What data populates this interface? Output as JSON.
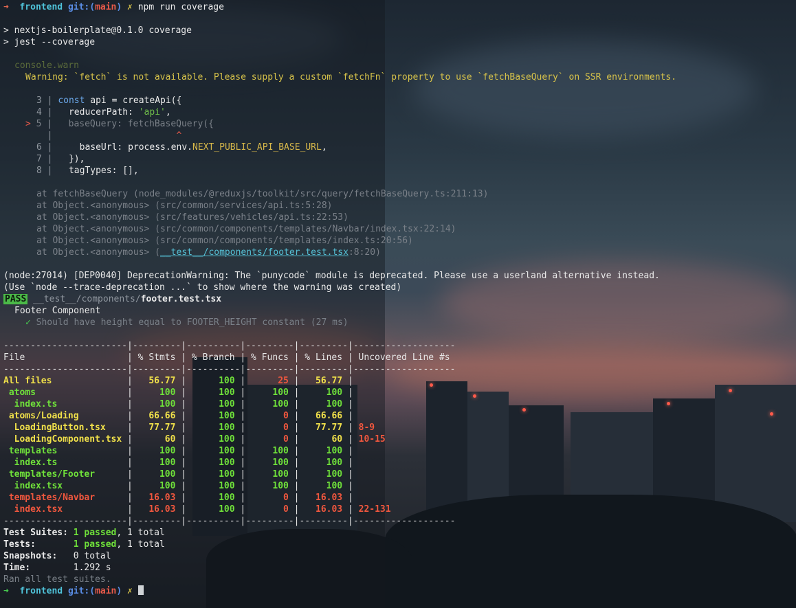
{
  "prompt": {
    "arrow": "➜",
    "dir": "frontend",
    "git_label": "git:",
    "branch_open": "(",
    "branch": "main",
    "branch_close": ")",
    "dirty": "✗",
    "command": "npm run coverage"
  },
  "npm_lines": [
    "> nextjs-boilerplate@0.1.0 coverage",
    "> jest --coverage"
  ],
  "console_warn": {
    "label": "console.warn",
    "message": "Warning: `fetch` is not available. Please supply a custom `fetchFn` property to use `fetchBaseQuery` on SSR environments."
  },
  "code_frame": {
    "l3_num": "3",
    "l3_kw": "const",
    "l3_rest": " api = createApi({",
    "l4_num": "4",
    "l4_a": "reducerPath: ",
    "l4_str": "'api'",
    "l4_b": ",",
    "l5_marker": ">",
    "l5_num": "5",
    "l5_code": "baseQuery: fetchBaseQuery({",
    "caret": "^",
    "l6_num": "6",
    "l6_a": "baseUrl: process.env.",
    "l6_env": "NEXT_PUBLIC_API_BASE_URL",
    "l6_b": ",",
    "l7_num": "7",
    "l7_code": "}),",
    "l8_num": "8",
    "l8_code": "tagTypes: [],"
  },
  "stack": [
    "at fetchBaseQuery (node_modules/@reduxjs/toolkit/src/query/fetchBaseQuery.ts:211:13)",
    "at Object.<anonymous> (src/common/services/api.ts:5:28)",
    "at Object.<anonymous> (src/features/vehicles/api.ts:22:53)",
    "at Object.<anonymous> (src/common/components/templates/Navbar/index.tsx:22:14)",
    "at Object.<anonymous> (src/common/components/templates/index.ts:20:56)"
  ],
  "stack_last": {
    "prefix": "at Object.<anonymous> (",
    "link": "__test__/components/footer.test.tsx",
    "suffix": ":8:20)"
  },
  "deprecation": [
    "(node:27014) [DEP0040] DeprecationWarning: The `punycode` module is deprecated. Please use a userland alternative instead.",
    "(Use `node --trace-deprecation ...` to show where the warning was created)"
  ],
  "test_result": {
    "badge": "PASS",
    "path_dir": "__test__/components/",
    "path_file": "footer.test.tsx",
    "suite": "Footer Component",
    "check": "✓",
    "case": "Should have height equal to FOOTER_HEIGHT constant (27 ms)"
  },
  "coverage": {
    "separator": "-----------------------|---------|----------|---------|---------|-------------------",
    "header": "File                   | % Stmts | % Branch | % Funcs | % Lines | Uncovered Line #s ",
    "rows": [
      {
        "file": "All files",
        "stmts": "56.77",
        "branch": "100",
        "funcs": "25",
        "lines": "56.77",
        "uncovered": ""
      },
      {
        "file": " atoms",
        "stmts": "100",
        "branch": "100",
        "funcs": "100",
        "lines": "100",
        "uncovered": ""
      },
      {
        "file": "  index.ts",
        "stmts": "100",
        "branch": "100",
        "funcs": "100",
        "lines": "100",
        "uncovered": ""
      },
      {
        "file": " atoms/Loading",
        "stmts": "66.66",
        "branch": "100",
        "funcs": "0",
        "lines": "66.66",
        "uncovered": ""
      },
      {
        "file": "  LoadingButton.tsx",
        "stmts": "77.77",
        "branch": "100",
        "funcs": "0",
        "lines": "77.77",
        "uncovered": "8-9"
      },
      {
        "file": "  LoadingComponent.tsx",
        "stmts": "60",
        "branch": "100",
        "funcs": "0",
        "lines": "60",
        "uncovered": "10-15"
      },
      {
        "file": " templates",
        "stmts": "100",
        "branch": "100",
        "funcs": "100",
        "lines": "100",
        "uncovered": ""
      },
      {
        "file": "  index.ts",
        "stmts": "100",
        "branch": "100",
        "funcs": "100",
        "lines": "100",
        "uncovered": ""
      },
      {
        "file": " templates/Footer",
        "stmts": "100",
        "branch": "100",
        "funcs": "100",
        "lines": "100",
        "uncovered": ""
      },
      {
        "file": "  index.tsx",
        "stmts": "100",
        "branch": "100",
        "funcs": "100",
        "lines": "100",
        "uncovered": ""
      },
      {
        "file": " templates/Navbar",
        "stmts": "16.03",
        "branch": "100",
        "funcs": "0",
        "lines": "16.03",
        "uncovered": ""
      },
      {
        "file": "  index.tsx",
        "stmts": "16.03",
        "branch": "100",
        "funcs": "0",
        "lines": "16.03",
        "uncovered": "22-131"
      }
    ]
  },
  "summary": {
    "suites_label": "Test Suites: ",
    "suites_pass": "1 passed",
    "suites_total": ", 1 total",
    "tests_label": "Tests:       ",
    "tests_pass": "1 passed",
    "tests_total": ", 1 total",
    "snap_label": "Snapshots:   ",
    "snap_val": "0 total",
    "time_label": "Time:        ",
    "time_val": "1.292 s",
    "ran": "Ran all test suites."
  },
  "colors": {
    "green": "#46c94e",
    "red": "#f0573e",
    "yellow": "#f0e04a",
    "cyan": "#4fc3d9"
  }
}
